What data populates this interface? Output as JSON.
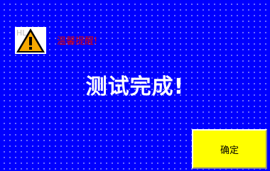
{
  "colors": {
    "background": "#0000ff",
    "warning_text": "#e00000",
    "message_text": "#ffffff",
    "button_background": "#ffff00"
  },
  "alert": {
    "icon": "warning-triangle-icon",
    "icon_overlay_text": "HL",
    "warning_label": "温馨提醒!",
    "message": "测试完成!"
  },
  "buttons": {
    "confirm_label": "确定"
  }
}
